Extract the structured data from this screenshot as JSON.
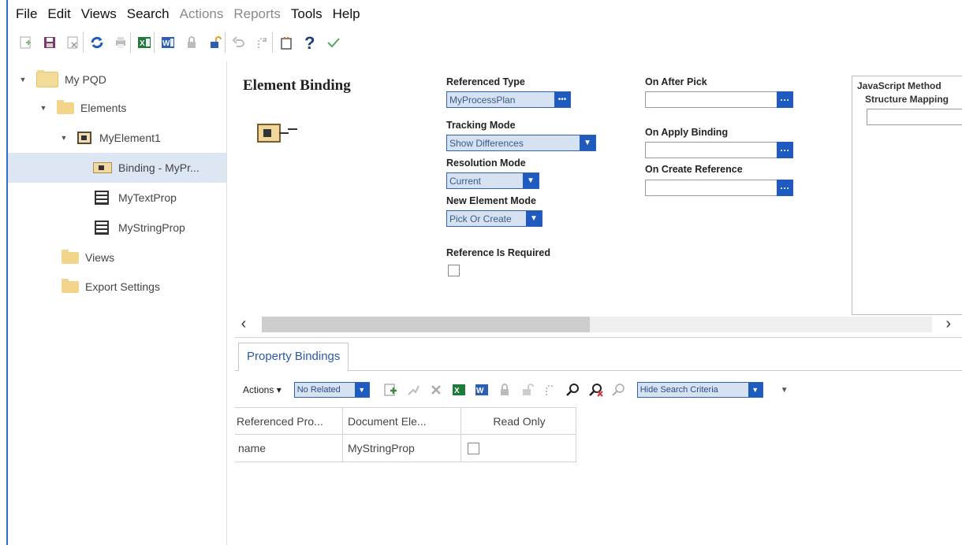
{
  "menu": [
    "File",
    "Edit",
    "Views",
    "Search",
    "Actions",
    "Reports",
    "Tools",
    "Help"
  ],
  "menu_disabled": [
    "Actions",
    "Reports"
  ],
  "toolbar_icons": [
    "new-icon",
    "save-icon",
    "cancel-icon",
    "refresh-icon",
    "print-icon",
    "excel-icon",
    "word-icon",
    "lock-icon",
    "unlock-icon",
    "undo-icon",
    "redo-icon",
    "tag-icon",
    "help-icon",
    "check-icon"
  ],
  "tree": {
    "root": "My PQD",
    "elements": "Elements",
    "element1": "MyElement1",
    "binding": "Binding - MyPr...",
    "textprop": "MyTextProp",
    "stringprop": "MyStringProp",
    "views": "Views",
    "export": "Export Settings"
  },
  "detail": {
    "title": "Element Binding",
    "referenced_type_label": "Referenced Type",
    "referenced_type_value": "MyProcessPlan",
    "tracking_mode_label": "Tracking Mode",
    "tracking_mode_value": "Show Differences",
    "resolution_mode_label": "Resolution Mode",
    "resolution_mode_value": "Current",
    "new_element_mode_label": "New Element Mode",
    "new_element_mode_value": "Pick Or Create",
    "reference_required_label": "Reference Is Required",
    "on_after_pick_label": "On After Pick",
    "on_apply_binding_label": "On Apply Binding",
    "on_create_reference_label": "On Create Reference",
    "js_method_label": "JavaScript Method",
    "structure_mapping_label": "Structure Mapping"
  },
  "bottom": {
    "tab": "Property Bindings",
    "actions_label": "Actions",
    "related_filter": "No Related",
    "search_criteria": "Hide Search Criteria",
    "columns": [
      "Referenced Pro...",
      "Document Ele...",
      "Read Only"
    ],
    "rows": [
      {
        "referenced": "name",
        "document": "MyStringProp",
        "read_only": false
      }
    ]
  },
  "colors": {
    "accent": "#1f5bbf",
    "selection": "#dde6f3",
    "folder": "#f2d58b"
  }
}
